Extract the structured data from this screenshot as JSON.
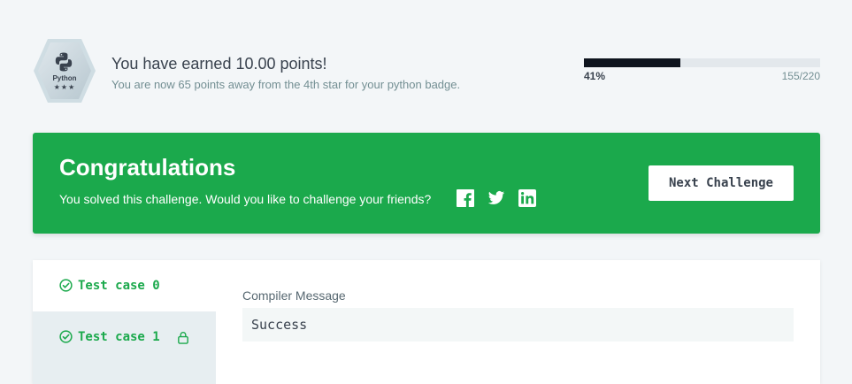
{
  "badge": {
    "label": "Python",
    "stars": "★★★",
    "icon": "python-logo-icon"
  },
  "earned": {
    "title": "You have earned 10.00 points!",
    "subtitle": "You are now 65 points away from the 4th star for your python badge."
  },
  "progress": {
    "percent_label": "41%",
    "count_label": "155/220",
    "fraction": 0.41
  },
  "congrats": {
    "title": "Congratulations",
    "subtitle": "You solved this challenge. Would you like to challenge your friends?",
    "share_icons": [
      "facebook-icon",
      "twitter-icon",
      "linkedin-icon"
    ],
    "next_button": "Next Challenge"
  },
  "tests": {
    "tabs": [
      {
        "label": "Test case 0",
        "locked": false
      },
      {
        "label": "Test case 1",
        "locked": true
      }
    ]
  },
  "compiler": {
    "label": "Compiler Message",
    "message": "Success"
  },
  "colors": {
    "success": "#1ba94c",
    "dark": "#0e141e",
    "page_bg": "#f3f6f8"
  }
}
